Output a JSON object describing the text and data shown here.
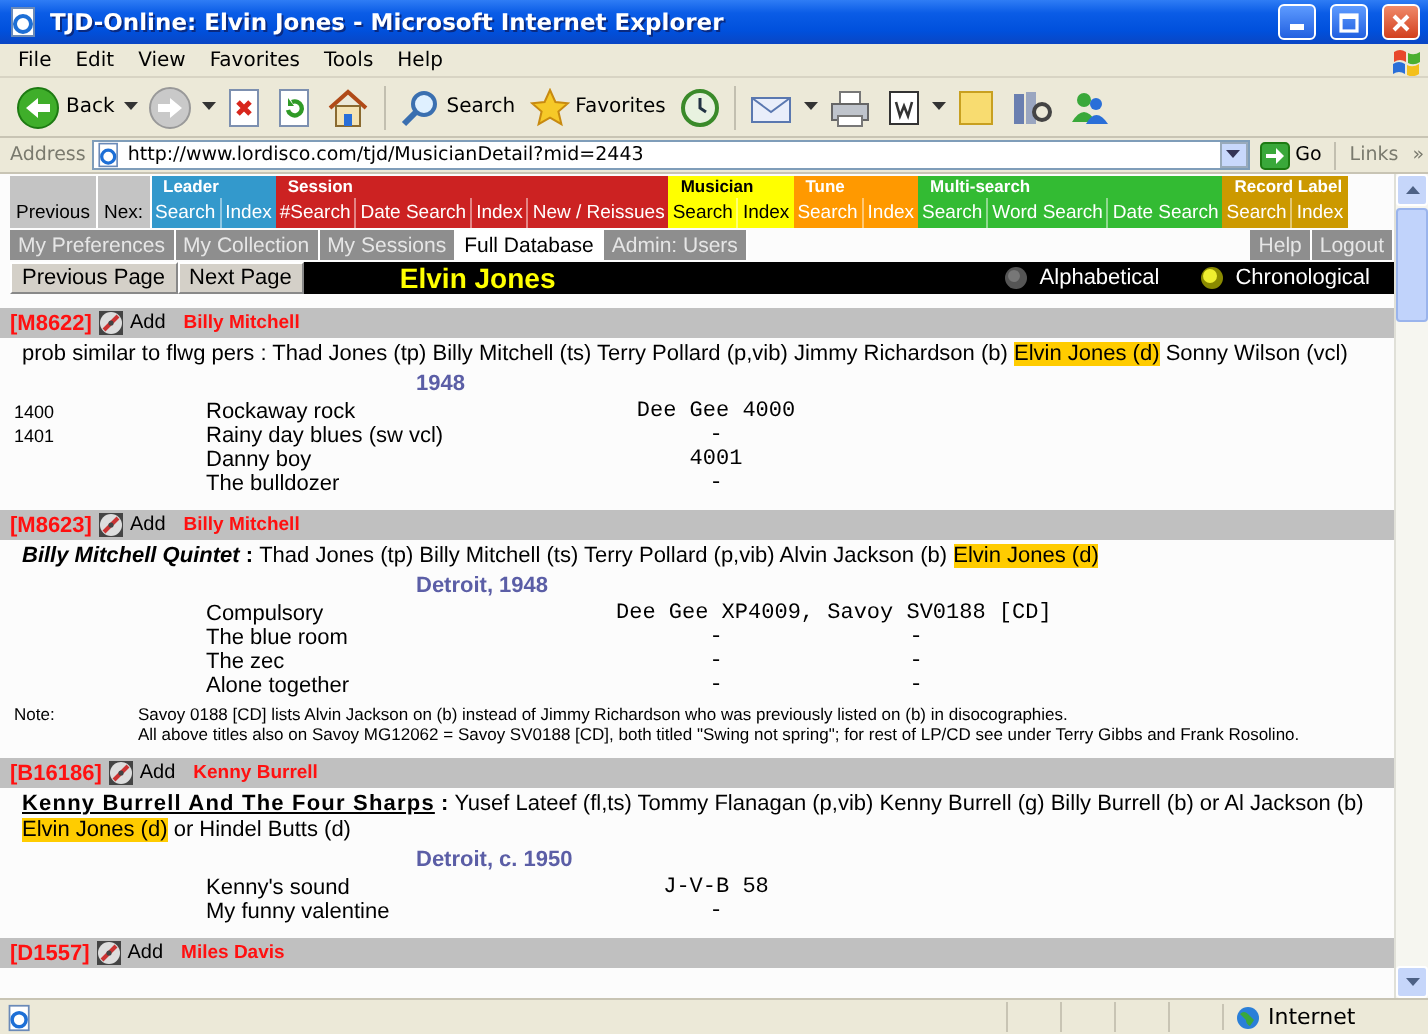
{
  "window": {
    "title": "TJD-Online: Elvin Jones - Microsoft Internet Explorer"
  },
  "menu": [
    "File",
    "Edit",
    "View",
    "Favorites",
    "Tools",
    "Help"
  ],
  "toolbar": {
    "back": "Back",
    "search": "Search",
    "favorites": "Favorites"
  },
  "address_bar": {
    "label": "Address",
    "url": "http://www.lordisco.com/tjd/MusicianDetail?mid=2443",
    "go": "Go",
    "links": "Links",
    "more": "»"
  },
  "nav": {
    "history": [
      "Previous",
      "Nex:"
    ],
    "groups": [
      {
        "label": "Leader",
        "color": "#3399cc",
        "buttons": [
          "Search",
          "Index"
        ]
      },
      {
        "label": "Session",
        "color": "#cc2222",
        "buttons": [
          "#Search",
          "Date Search",
          "Index",
          "New / Reissues"
        ]
      },
      {
        "label": "Musician",
        "color": "#ffff00",
        "buttons": [
          "Search",
          "Index"
        ]
      },
      {
        "label": "Tune",
        "color": "#ff9900",
        "buttons": [
          "Search",
          "Index"
        ]
      },
      {
        "label": "Multi-search",
        "color": "#33bb33",
        "buttons": [
          "Search",
          "Word Search",
          "Date Search"
        ]
      },
      {
        "label": "Record Label",
        "color": "#cc9900",
        "buttons": [
          "Search",
          "Index"
        ]
      }
    ]
  },
  "tabs": {
    "items": [
      {
        "label": "My Preferences",
        "selected": false
      },
      {
        "label": "My Collection",
        "selected": false
      },
      {
        "label": "My Sessions",
        "selected": false
      },
      {
        "label": "Full Database",
        "selected": true
      },
      {
        "label": "Admin: Users",
        "selected": false
      }
    ],
    "right": [
      "Help",
      "Logout"
    ]
  },
  "page_bar": {
    "buttons": [
      "Previous Page",
      "Next Page"
    ],
    "musician": "Elvin Jones",
    "order_options": [
      {
        "label": "Alphabetical",
        "selected": false
      },
      {
        "label": "Chronological",
        "selected": true
      }
    ]
  },
  "sessions": [
    {
      "id": "[M8622]",
      "add": "Add",
      "leader": "Billy Mitchell",
      "band": {
        "kind": "plain",
        "text": "prob similar to flwg pers"
      },
      "separator": ":",
      "personnel": [
        {
          "text": "Thad Jones (tp) Billy Mitchell (ts) Terry Pollard (p,vib) Jimmy Richardson (b)",
          "highlight": false
        },
        {
          "text": "Elvin Jones (d)",
          "highlight": true
        },
        {
          "text": "Sonny Wilson (vcl)",
          "highlight": false
        }
      ],
      "location": "1948",
      "tracks": [
        {
          "matrix": "1400",
          "title": "Rockaway rock",
          "issues": [
            "Dee Gee 4000"
          ]
        },
        {
          "matrix": "1401",
          "title": "Rainy day blues (sw vcl)",
          "issues": [
            "-"
          ]
        },
        {
          "title": "Danny boy",
          "issues": [
            "4001"
          ]
        },
        {
          "title": "The bulldozer",
          "issues": [
            "-"
          ]
        }
      ]
    },
    {
      "id": "[M8623]",
      "add": "Add",
      "leader": "Billy Mitchell",
      "band": {
        "kind": "italic",
        "text": "Billy Mitchell Quintet"
      },
      "separator": ":",
      "personnel": [
        {
          "text": "Thad Jones (tp) Billy Mitchell (ts) Terry Pollard (p,vib) Alvin Jackson (b)",
          "highlight": false
        },
        {
          "text": "Elvin Jones (d)",
          "highlight": true
        }
      ],
      "location": "Detroit, 1948",
      "tracks": [
        {
          "title": "Compulsory",
          "issues": [
            "Dee Gee XP4009, Savoy SV0188 [CD]"
          ]
        },
        {
          "title": "The blue room",
          "issues": [
            "-",
            "-"
          ]
        },
        {
          "title": "The zec",
          "issues": [
            "-",
            "-"
          ]
        },
        {
          "title": "Alone together",
          "issues": [
            "-",
            "-"
          ]
        }
      ],
      "note": {
        "label": "Note:",
        "lines": [
          "Savoy 0188 [CD] lists Alvin Jackson on (b) instead of Jimmy Richardson who was previously listed on (b) in disocographies.",
          "All above titles also on Savoy MG12062 = Savoy SV0188 [CD], both titled \"Swing not spring\"; for rest of LP/CD see under Terry Gibbs and Frank Rosolino."
        ]
      }
    },
    {
      "id": "[B16186]",
      "add": "Add",
      "leader": "Kenny Burrell",
      "band": {
        "kind": "underline",
        "text": "Kenny Burrell And The Four Sharps"
      },
      "separator": ":",
      "personnel": [
        {
          "text": "Yusef Lateef (fl,ts) Tommy Flanagan (p,vib) Kenny Burrell (g) Billy Burrell (b) or Al Jackson (b)",
          "highlight": false
        },
        {
          "text": "Elvin Jones (d)",
          "highlight": true
        },
        {
          "text": "or Hindel Butts (d)",
          "highlight": false
        }
      ],
      "location": "Detroit, c. 1950",
      "tracks": [
        {
          "title": "Kenny's sound",
          "issues": [
            "J-V-B 58"
          ]
        },
        {
          "title": "My funny valentine",
          "issues": [
            "-"
          ]
        }
      ]
    },
    {
      "id": "[D1557]",
      "add": "Add",
      "leader": "Miles Davis"
    }
  ],
  "status_bar": {
    "zone": "Internet"
  }
}
